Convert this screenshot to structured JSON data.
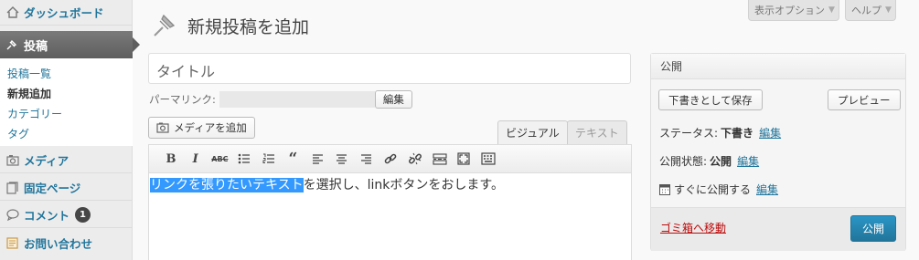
{
  "sidebar": {
    "dashboard": "ダッシュボード",
    "posts": "投稿",
    "submenu": [
      "投稿一覧",
      "新規追加",
      "カテゴリー",
      "タグ"
    ],
    "media": "メディア",
    "pages": "固定ページ",
    "comments": "コメント",
    "comments_count": "1",
    "contact": "お問い合わせ"
  },
  "screen_tabs": {
    "screen_options": "表示オプション",
    "help": "ヘルプ"
  },
  "page_title": "新規投稿を追加",
  "title_field": {
    "value": "タイトル"
  },
  "permalink": {
    "label": "パーマリンク:",
    "edit": "編集"
  },
  "media_button": "メディアを追加",
  "editor_tabs": {
    "visual": "ビジュアル",
    "text": "テキスト"
  },
  "toolbar_icons": [
    "bold-icon",
    "italic-icon",
    "strikethrough-icon",
    "bullet-list-icon",
    "numbered-list-icon",
    "blockquote-icon",
    "align-left-icon",
    "align-center-icon",
    "align-right-icon",
    "link-icon",
    "unlink-icon",
    "insert-more-icon",
    "fullscreen-icon",
    "kitchen-sink-icon"
  ],
  "editor": {
    "selected": "リンクを張りたいテキスト",
    "rest": "を選択し、linkボタンをおします。"
  },
  "publish": {
    "title": "公開",
    "save_draft": "下書きとして保存",
    "preview": "プレビュー",
    "status_label": "ステータス:",
    "status_value": "下書き",
    "visibility_label": "公開状態:",
    "visibility_value": "公開",
    "schedule": "すぐに公開する",
    "edit": "編集",
    "trash": "ゴミ箱へ移動",
    "publish_button": "公開"
  },
  "colors": {
    "link": "#21759b",
    "selection": "#3399ff",
    "publish_button": "#21759b",
    "trash": "#bc0b0b"
  }
}
